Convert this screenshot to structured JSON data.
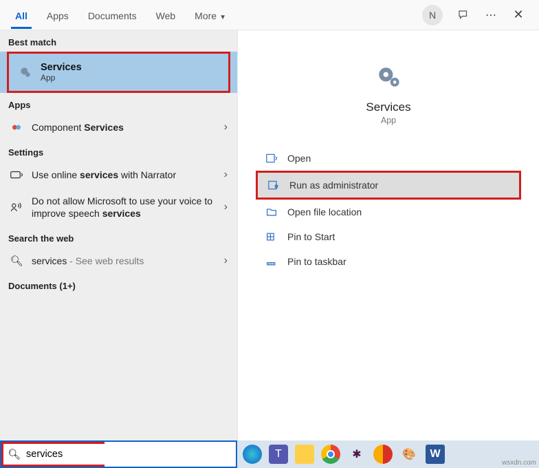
{
  "tabs": {
    "all": "All",
    "apps": "Apps",
    "documents": "Documents",
    "web": "Web",
    "more": "More"
  },
  "titlebar": {
    "avatar_initial": "N"
  },
  "sections": {
    "best_match": "Best match",
    "apps": "Apps",
    "settings": "Settings",
    "search_web": "Search the web",
    "documents_count": "Documents (1+)"
  },
  "best_match": {
    "title": "Services",
    "subtitle": "App"
  },
  "apps_results": {
    "component_prefix": "Component ",
    "component_bold": "Services"
  },
  "settings_results": {
    "online_prefix": "Use online ",
    "online_bold": "services",
    "online_suffix": " with Narrator",
    "speech_prefix": "Do not allow Microsoft to use your voice to improve speech ",
    "speech_bold": "services"
  },
  "web_results": {
    "term": "services",
    "hint": " - See web results"
  },
  "details": {
    "title": "Services",
    "subtitle": "App",
    "actions": {
      "open": "Open",
      "run_admin": "Run as administrator",
      "open_location": "Open file location",
      "pin_start": "Pin to Start",
      "pin_taskbar": "Pin to taskbar"
    }
  },
  "search": {
    "value": "services"
  },
  "watermark": "wsxdn.com"
}
